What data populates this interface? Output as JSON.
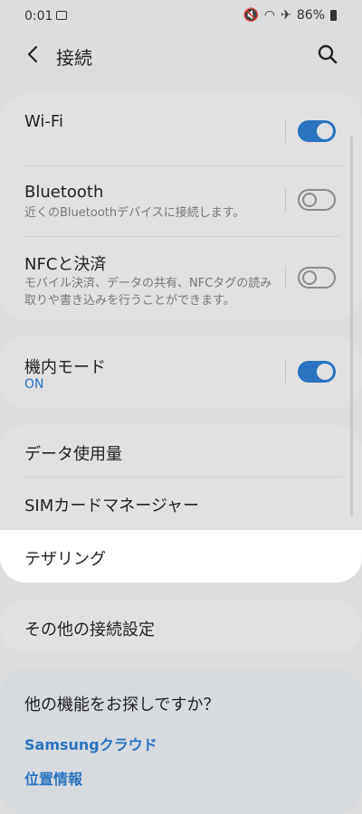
{
  "status_bar": {
    "time": "0:01",
    "battery": "86%"
  },
  "header": {
    "title": "接続"
  },
  "group1": {
    "wifi_label": "Wi-Fi",
    "bluetooth_label": "Bluetooth",
    "bluetooth_sub": "近くのBluetoothデバイスに接続します。",
    "nfc_label": "NFCと決済",
    "nfc_sub": "モバイル決済、データの共有、NFCタグの読み取りや書き込みを行うことができます。"
  },
  "group2": {
    "airplane_label": "機内モード",
    "airplane_status": "ON"
  },
  "group3": {
    "data_usage_label": "データ使用量",
    "sim_manager_label": "SIMカードマネージャー",
    "tethering_label": "テザリング"
  },
  "group4": {
    "other_label": "その他の接続設定"
  },
  "hint_card": {
    "title": "他の機能をお探しですか？",
    "links": [
      "Samsungクラウド",
      "位置情報"
    ]
  },
  "colors": {
    "accent": "#2a73c0",
    "highlight": "#ffffff"
  }
}
